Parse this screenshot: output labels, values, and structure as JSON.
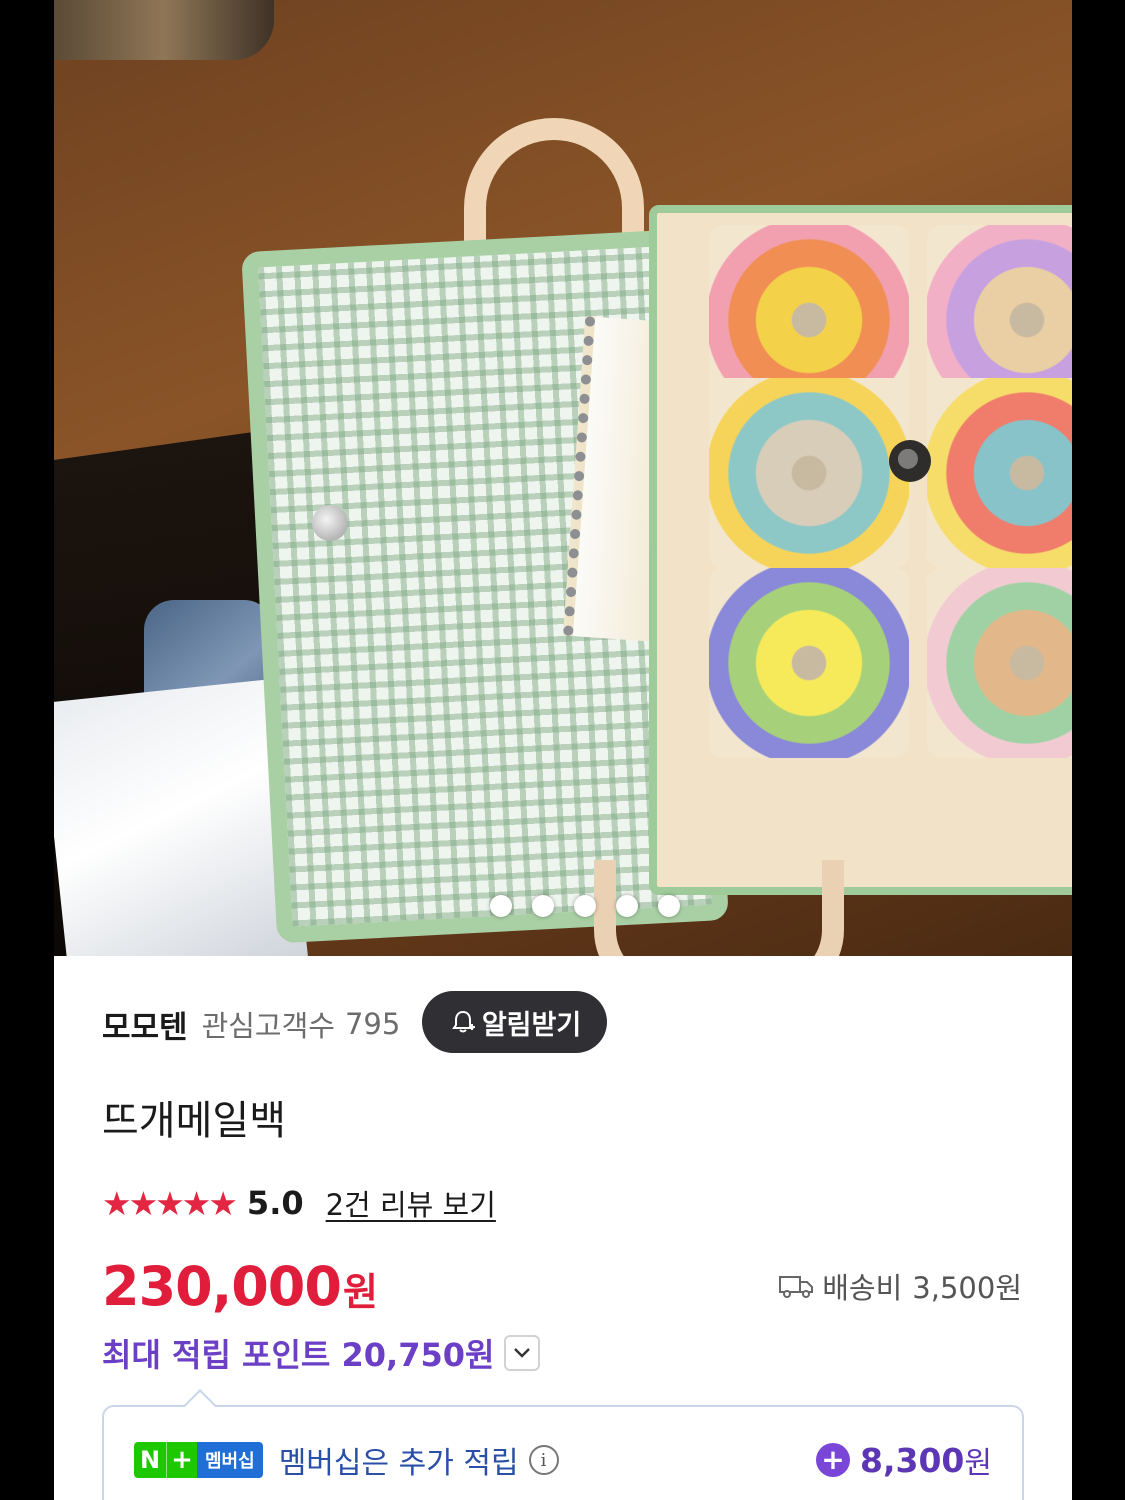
{
  "product_image": {
    "alt": "crochet granny-square mail bag",
    "slide_count": 5,
    "active_slide": 1
  },
  "seller": {
    "name": "모모텐",
    "follower_label": "관심고객수",
    "follower_count": "795",
    "notify_label": "알림받기"
  },
  "product": {
    "title": "뜨개메일백",
    "stars": "★★★★★",
    "rating": "5.0",
    "review_link": "2건 리뷰 보기",
    "price": "230,000",
    "price_unit": "원",
    "shipping_label": "배송비",
    "shipping_value": "3,500원",
    "points_text": "최대 적립 포인트 20,750원"
  },
  "membership": {
    "badge_n": "N",
    "badge_plus": "+",
    "badge_label": "멤버십",
    "text": "멤버십은 추가 적립",
    "info_icon": "i",
    "amount": "8,300",
    "amount_unit": "원"
  },
  "colors": {
    "price": "#e01e3c",
    "points": "#6b3fc6",
    "star": "#e32642",
    "naver_green": "#1ec800"
  }
}
